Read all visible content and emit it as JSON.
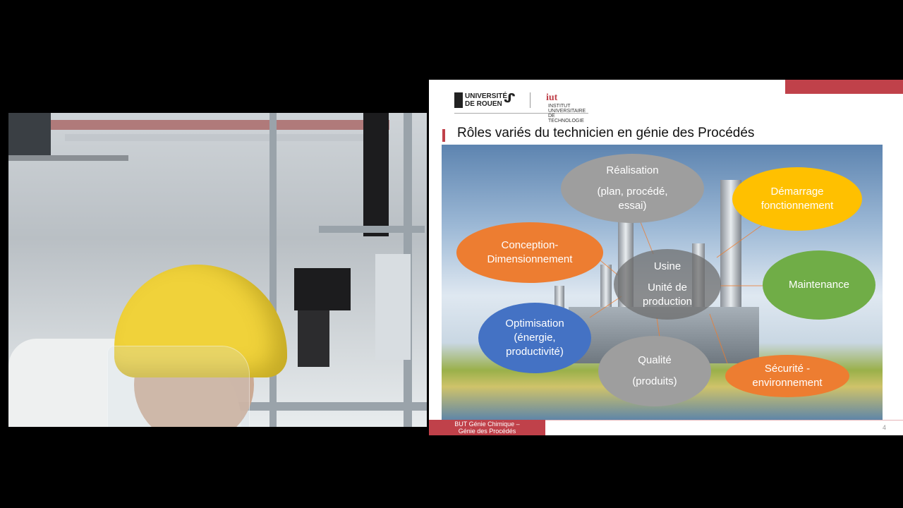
{
  "webcam": {
    "label": "presenter-webcam"
  },
  "slide": {
    "logos": {
      "university_line1": "UNIVERSITÉ",
      "university_line2": "DE ROUEN",
      "iut_letters": "iut",
      "iut_text": "INSTITUT UNIVERSITAIRE DE TECHNOLOGIE"
    },
    "title": "Rôles variés du technicien en génie des Procédés",
    "bubbles": {
      "realisation": {
        "line1": "Réalisation",
        "line2": "(plan, procédé,",
        "line3": "essai)"
      },
      "demarrage": {
        "line1": "Démarrage",
        "line2": "fonctionnement"
      },
      "conception": {
        "line1": "Conception-",
        "line2": "Dimensionnement"
      },
      "usine": {
        "line1": "Usine",
        "line2": "Unité de",
        "line3": "production"
      },
      "maintenance": {
        "line1": "Maintenance"
      },
      "optimisation": {
        "line1": "Optimisation",
        "line2": "(énergie,",
        "line3": "productivité)"
      },
      "qualite": {
        "line1": "Qualité",
        "line2": "(produits)"
      },
      "securite": {
        "line1": "Sécurité -",
        "line2": "environnement"
      }
    },
    "footer": {
      "line1": "BUT Génie Chimique –",
      "line2": "Génie des Procédés"
    },
    "page_number": "4",
    "colors": {
      "accent": "#c0414a",
      "gray": "#9e9e9e",
      "orange": "#ed7d31",
      "yellow": "#ffc000",
      "green": "#70ad47",
      "blue": "#4472c4"
    }
  }
}
